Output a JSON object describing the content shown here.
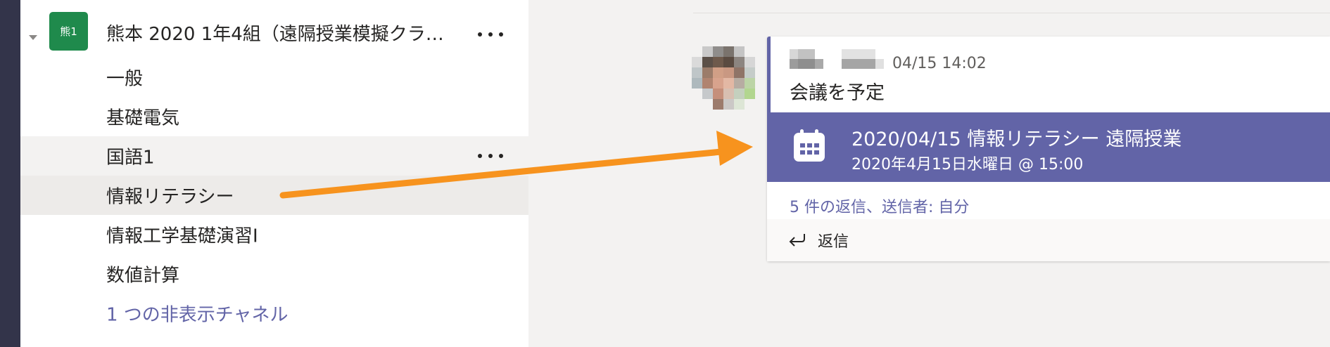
{
  "team": {
    "avatar_text": "熊1",
    "name": "熊本 2020 1年4組（遠隔授業模擬クラ…"
  },
  "channels": [
    {
      "label": "一般"
    },
    {
      "label": "基礎電気"
    },
    {
      "label": "国語1"
    },
    {
      "label": "情報リテラシー"
    },
    {
      "label": "情報工学基礎演習I"
    },
    {
      "label": "数値計算"
    }
  ],
  "hidden_channels_label": "1 つの非表示チャネル",
  "message": {
    "timestamp": "04/15 14:02",
    "text": "会議を予定",
    "meeting_title": "2020/04/15 情報リテラシー 遠隔授業",
    "meeting_datetime": "2020年4月15日水曜日 @ 15:00",
    "replies_text": "5 件の返信、送信者: 自分",
    "reply_label": "返信"
  },
  "icons": {
    "more": "more-options-icon",
    "calendar": "calendar-icon",
    "reply": "reply-arrow-icon",
    "expand": "chevron-down-icon"
  },
  "colors": {
    "brand": "#6264a7",
    "team_avatar": "#1f8a4c",
    "annotation_arrow": "#f7931e"
  }
}
